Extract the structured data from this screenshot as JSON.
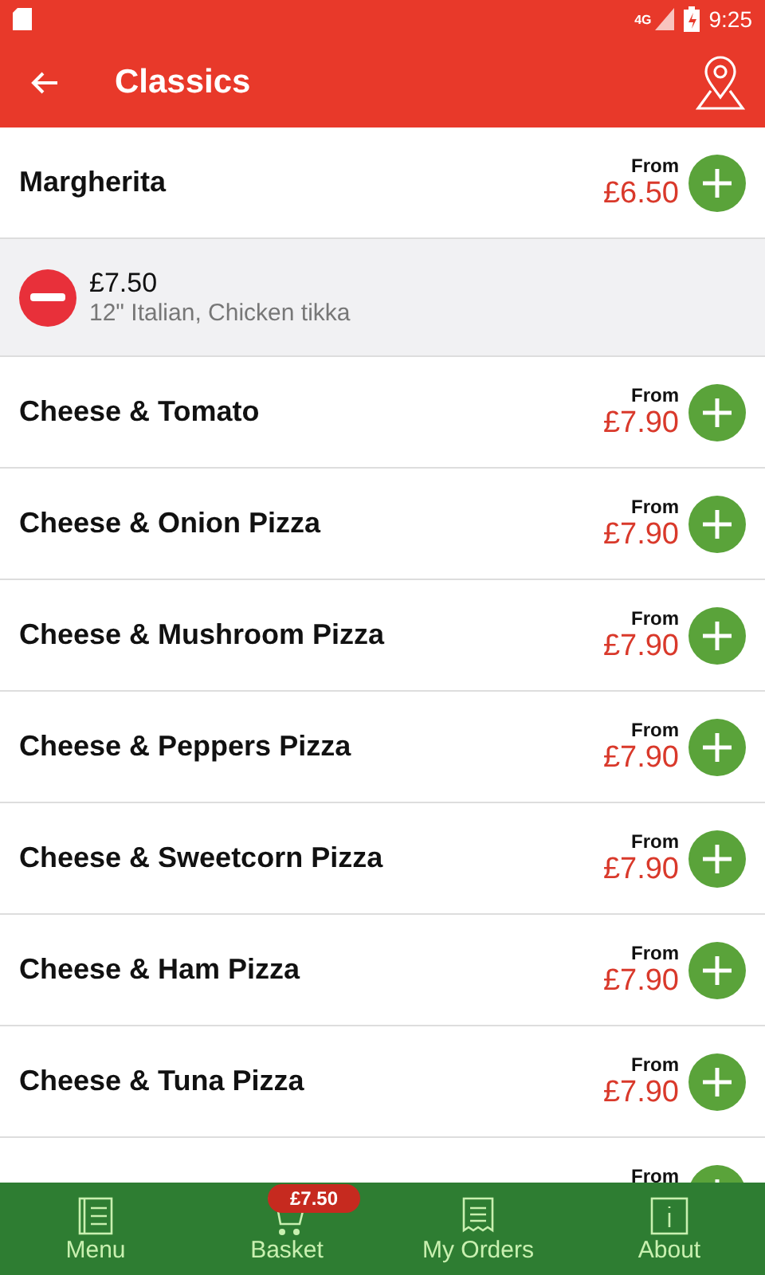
{
  "status_bar": {
    "time": "9:25",
    "network": "4G"
  },
  "app_bar": {
    "title": "Classics"
  },
  "items": [
    {
      "kind": "product",
      "name": "Margherita",
      "from": "From",
      "price": "£6.50"
    },
    {
      "kind": "basket_line",
      "price": "£7.50",
      "detail": "12\" Italian, Chicken tikka"
    },
    {
      "kind": "product",
      "name": "Cheese & Tomato",
      "from": "From",
      "price": "£7.90"
    },
    {
      "kind": "product",
      "name": "Cheese & Onion Pizza",
      "from": "From",
      "price": "£7.90"
    },
    {
      "kind": "product",
      "name": "Cheese & Mushroom Pizza",
      "from": "From",
      "price": "£7.90"
    },
    {
      "kind": "product",
      "name": "Cheese & Peppers Pizza",
      "from": "From",
      "price": "£7.90"
    },
    {
      "kind": "product",
      "name": "Cheese & Sweetcorn Pizza",
      "from": "From",
      "price": "£7.90"
    },
    {
      "kind": "product",
      "name": "Cheese & Ham Pizza",
      "from": "From",
      "price": "£7.90"
    },
    {
      "kind": "product",
      "name": "Cheese & Tuna Pizza",
      "from": "From",
      "price": "£7.90"
    },
    {
      "kind": "product",
      "from": "From"
    }
  ],
  "bottom_nav": [
    {
      "kind": "menu",
      "label": "Menu"
    },
    {
      "kind": "basket",
      "label": "Basket",
      "badge": "£7.50"
    },
    {
      "kind": "orders",
      "label": "My Orders"
    },
    {
      "kind": "about",
      "label": "About"
    }
  ]
}
